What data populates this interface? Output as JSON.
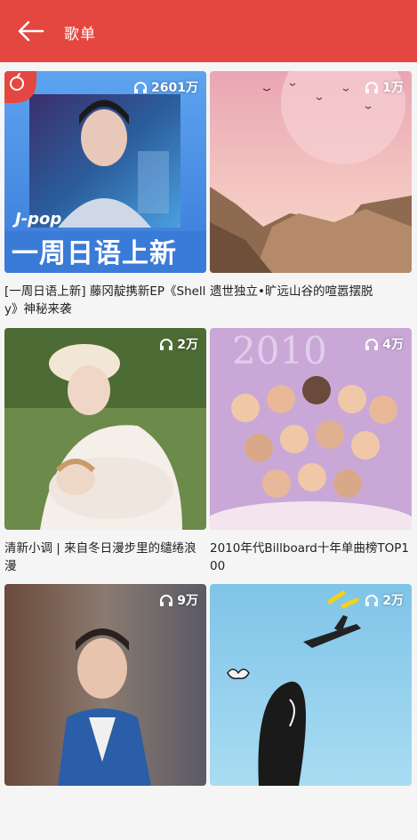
{
  "header": {
    "title": "歌单",
    "bg_color": "#e4473f"
  },
  "playlists": [
    {
      "plays": "2601万",
      "cover_text_top": "J-pop",
      "cover_text_main": "一周日语上新",
      "caption": "[一周日语上新] 藤冈靛携新EP《Shelly》神秘来袭"
    },
    {
      "plays": "1万",
      "caption": "遗世独立•旷远山谷的喧嚣摆脱"
    },
    {
      "plays": "2万",
      "caption": "清新小调 | 来自冬日漫步里的缱绻浪漫"
    },
    {
      "plays": "4万",
      "caption": "2010年代Billboard十年单曲榜TOP100"
    },
    {
      "plays": "9万",
      "caption": ""
    },
    {
      "plays": "2万",
      "caption": ""
    }
  ]
}
